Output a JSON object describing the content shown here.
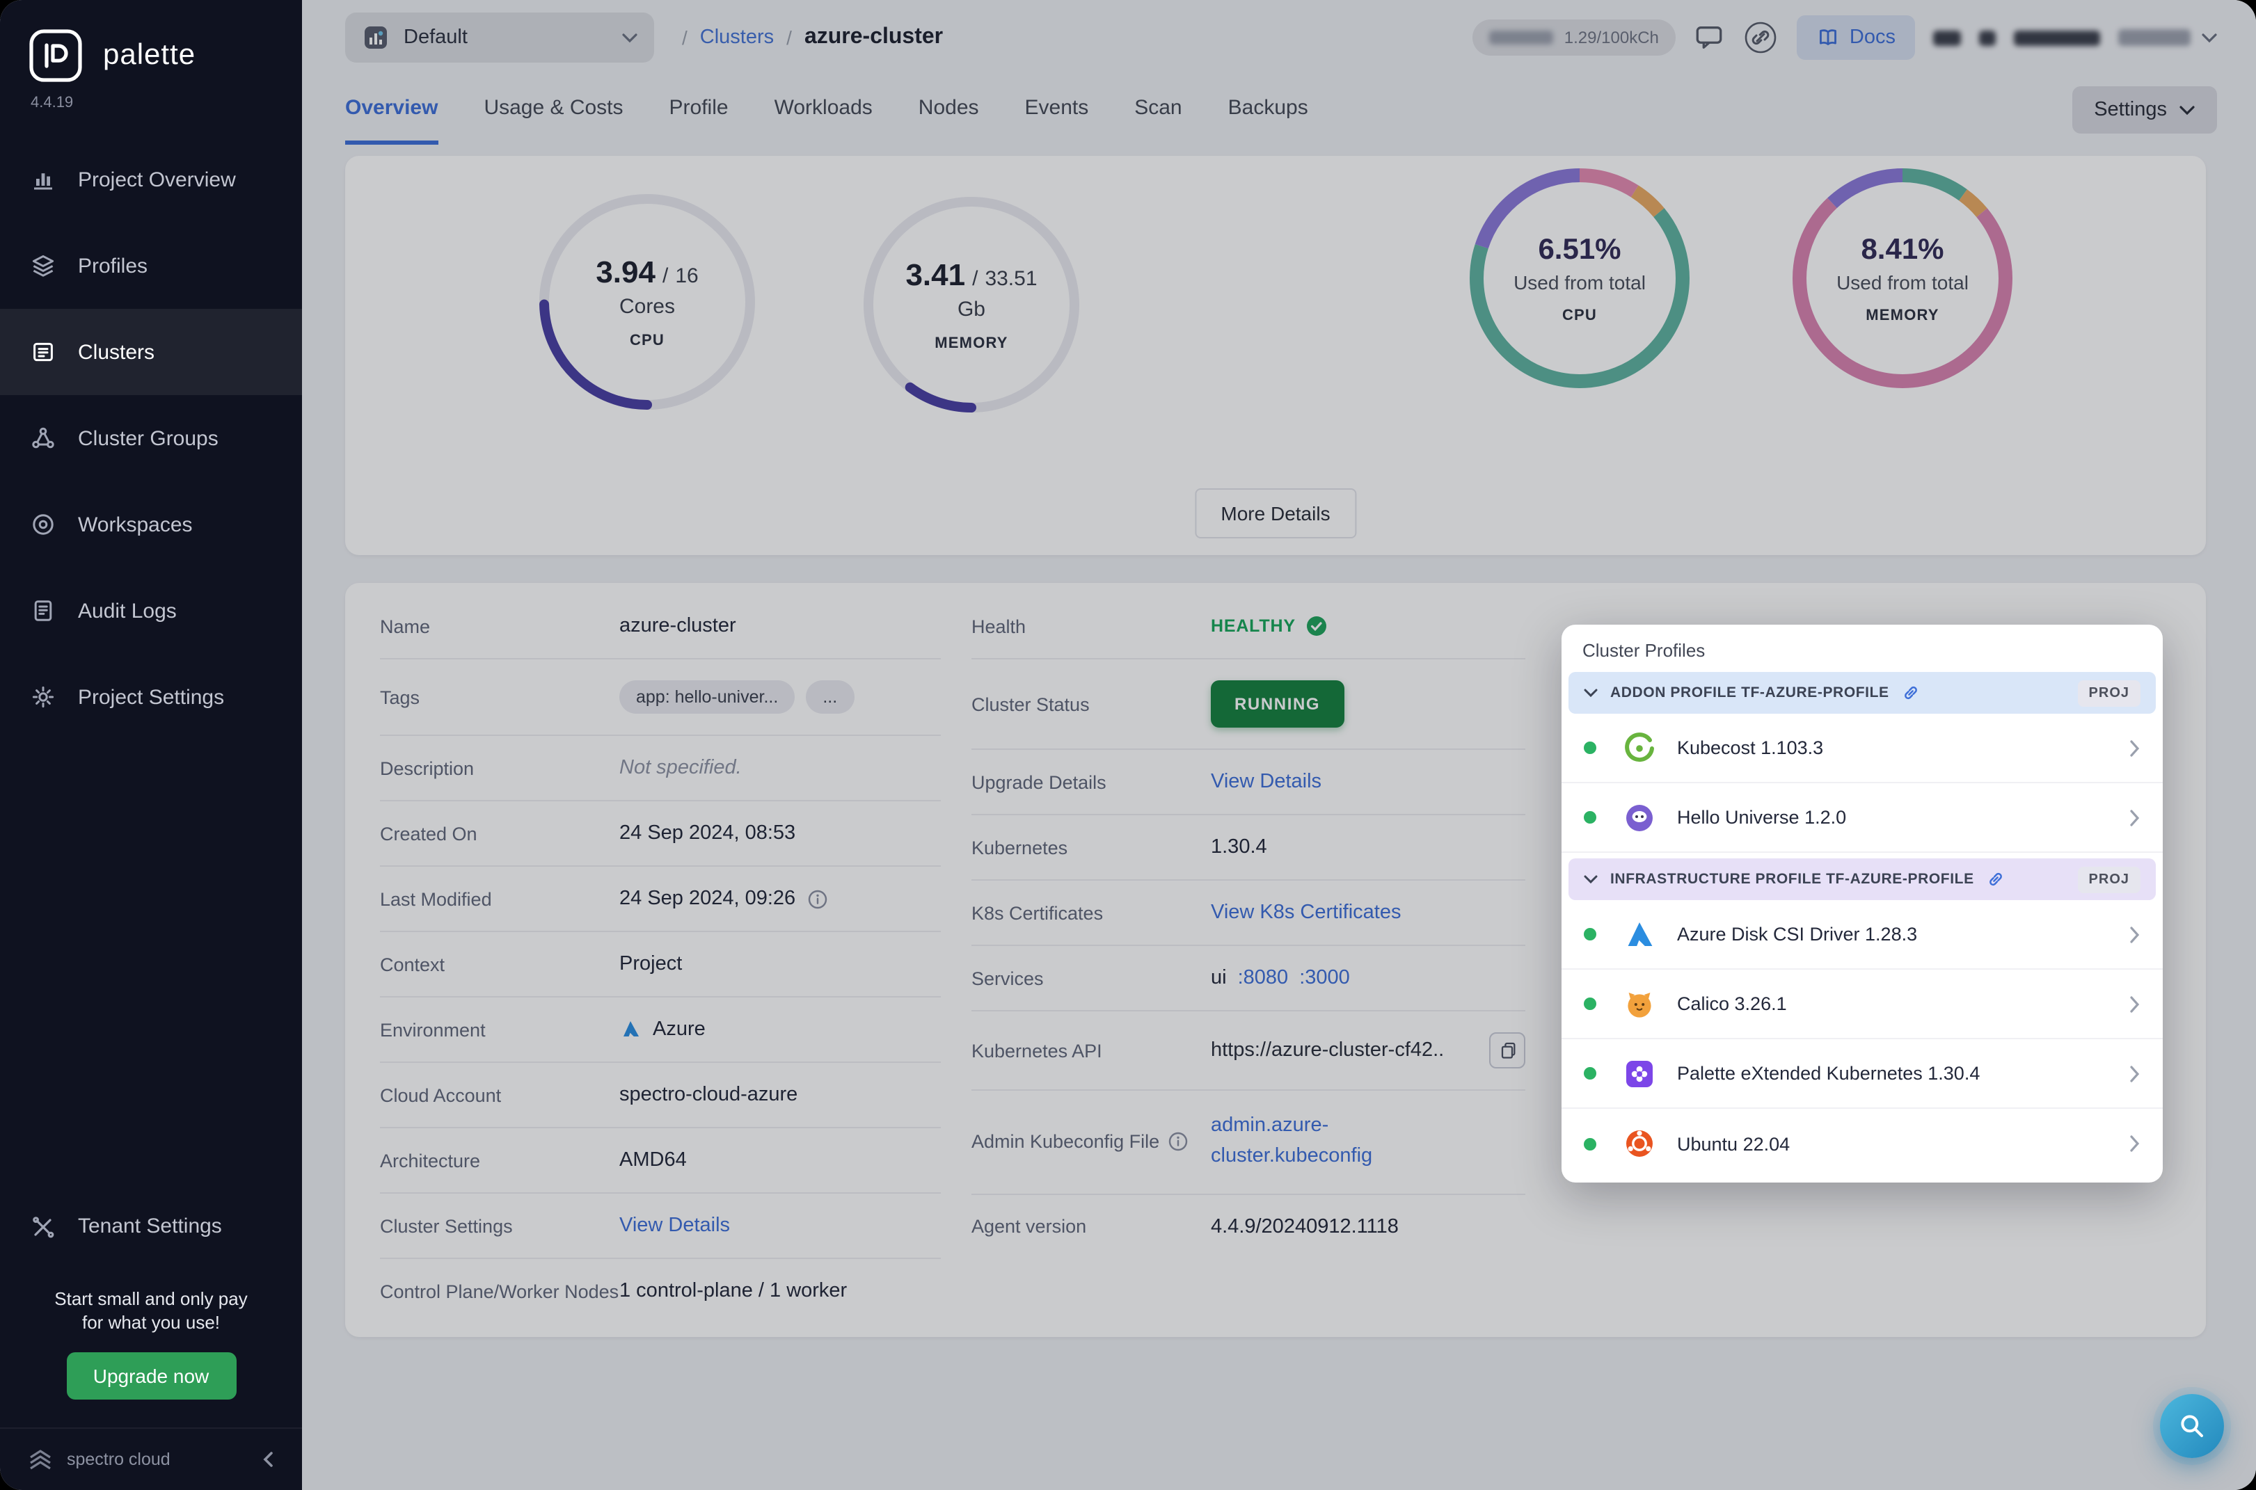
{
  "brand": {
    "name": "palette",
    "version": "4.4.19",
    "footer": "spectro cloud"
  },
  "sidebar": {
    "items": [
      {
        "label": "Project Overview"
      },
      {
        "label": "Profiles"
      },
      {
        "label": "Clusters"
      },
      {
        "label": "Cluster Groups"
      },
      {
        "label": "Workspaces"
      },
      {
        "label": "Audit Logs"
      },
      {
        "label": "Project Settings"
      }
    ],
    "tenant_settings": "Tenant Settings",
    "promo": "Start small and only pay for what you use!",
    "upgrade_label": "Upgrade now"
  },
  "header": {
    "project_selector": "Default",
    "breadcrumb_sep": "/",
    "breadcrumb_section": "Clusters",
    "breadcrumb_current": "azure-cluster",
    "usage": "1.29/100kCh",
    "docs_label": "Docs"
  },
  "tabs": {
    "labels": [
      "Overview",
      "Usage & Costs",
      "Profile",
      "Workloads",
      "Nodes",
      "Events",
      "Scan",
      "Backups"
    ],
    "active": "Overview",
    "settings_label": "Settings"
  },
  "metrics": {
    "cpu_gauge": {
      "value": "3.94",
      "sep": "/",
      "total": "16",
      "unit": "Cores",
      "label": "CPU",
      "fraction": 0.246
    },
    "memory_gauge": {
      "value": "3.41",
      "sep": "/",
      "total": "33.51",
      "unit": "Gb",
      "label": "MEMORY",
      "fraction": 0.102
    },
    "cpu_donut": {
      "percent": "6.51%",
      "caption": "Used from total",
      "label": "CPU"
    },
    "memory_donut": {
      "percent": "8.41%",
      "caption": "Used from total",
      "label": "MEMORY"
    },
    "more_details_label": "More Details"
  },
  "details": {
    "name": {
      "label": "Name",
      "value": "azure-cluster"
    },
    "tags": {
      "label": "Tags",
      "chip": "app: hello-univer...",
      "more": "..."
    },
    "description": {
      "label": "Description",
      "value": "Not specified."
    },
    "created_on": {
      "label": "Created On",
      "value": "24 Sep 2024, 08:53"
    },
    "last_modified": {
      "label": "Last Modified",
      "value": "24 Sep 2024, 09:26"
    },
    "context": {
      "label": "Context",
      "value": "Project"
    },
    "environment": {
      "label": "Environment",
      "value": "Azure"
    },
    "cloud_account": {
      "label": "Cloud Account",
      "value": "spectro-cloud-azure"
    },
    "architecture": {
      "label": "Architecture",
      "value": "AMD64"
    },
    "cluster_settings": {
      "label": "Cluster Settings",
      "value": "View Details"
    },
    "nodes": {
      "label": "Control Plane/Worker Nodes",
      "value": "1 control-plane / 1 worker"
    },
    "health": {
      "label": "Health",
      "value": "HEALTHY"
    },
    "cluster_status": {
      "label": "Cluster Status",
      "value": "RUNNING"
    },
    "upgrade_details": {
      "label": "Upgrade Details",
      "value": "View Details"
    },
    "kubernetes": {
      "label": "Kubernetes",
      "value": "1.30.4"
    },
    "k8s_certificates": {
      "label": "K8s Certificates",
      "value": "View K8s Certificates"
    },
    "services": {
      "label": "Services",
      "prefix": "ui",
      "port1": ":8080",
      "port2": ":3000"
    },
    "kubernetes_api": {
      "label": "Kubernetes API",
      "value": "https://azure-cluster-cf42..."
    },
    "kubeconfig": {
      "label": "Admin Kubeconfig File",
      "value": "admin.azure-cluster.kubeconfig"
    },
    "agent_version": {
      "label": "Agent version",
      "value": "4.4.9/20240912.1118"
    }
  },
  "popover": {
    "title": "Cluster Profiles",
    "sections": [
      {
        "name": "ADDON PROFILE TF-AZURE-PROFILE",
        "badge": "PROJ",
        "items": [
          {
            "name": "Kubecost 1.103.3"
          },
          {
            "name": "Hello Universe 1.2.0"
          }
        ]
      },
      {
        "name": "INFRASTRUCTURE PROFILE TF-AZURE-PROFILE",
        "badge": "PROJ",
        "items": [
          {
            "name": "Azure Disk CSI Driver 1.28.3"
          },
          {
            "name": "Calico 3.26.1"
          },
          {
            "name": "Palette eXtended Kubernetes 1.30.4"
          },
          {
            "name": "Ubuntu 22.04"
          }
        ]
      }
    ]
  },
  "colors": {
    "accent_purple": "#4a3fa3",
    "link_blue": "#3e6fd8",
    "healthy_green": "#18a65a",
    "running_green": "#17803f",
    "upgrade_green": "#2e9e57",
    "donut_teal": "#5fb3a1",
    "donut_pink": "#d983b0"
  }
}
